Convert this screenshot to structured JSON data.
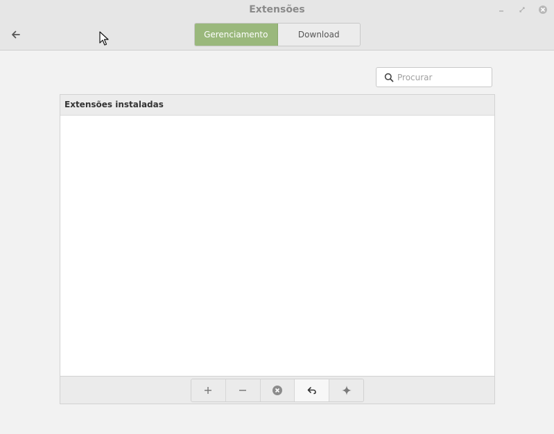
{
  "window": {
    "title": "Extensões"
  },
  "header": {
    "tabs": [
      {
        "label": "Gerenciamento",
        "active": true
      },
      {
        "label": "Download",
        "active": false
      }
    ]
  },
  "search": {
    "placeholder": "Procurar",
    "value": ""
  },
  "panel": {
    "title": "Extensões instaladas",
    "items": []
  },
  "toolbar": {
    "buttons": [
      {
        "icon": "plus-icon"
      },
      {
        "icon": "minus-icon"
      },
      {
        "icon": "remove-circle-icon"
      },
      {
        "icon": "undo-icon"
      },
      {
        "icon": "sparkle-icon"
      }
    ]
  },
  "colors": {
    "accent": "#9ab87c",
    "header_bg": "#e6e6e6",
    "window_bg": "#f2f2f2"
  }
}
